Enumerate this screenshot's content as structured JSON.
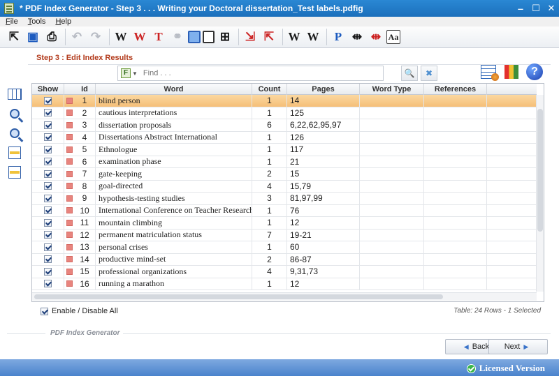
{
  "window": {
    "title": "* PDF Index Generator - Step 3 . . . Writing your Doctoral dissertation_Test labels.pdfig",
    "minimize": "‒",
    "maximize": "☐",
    "close": "✕"
  },
  "menu": {
    "file": "File",
    "tools": "Tools",
    "help": "Help"
  },
  "step": {
    "title": "Step 3 : Edit Index Results"
  },
  "search": {
    "placeholder": "Find . . ."
  },
  "grid": {
    "headers": {
      "show": "Show",
      "id": "Id",
      "word": "Word",
      "count": "Count",
      "pages": "Pages",
      "word_type": "Word Type",
      "references": "References"
    },
    "rows": [
      {
        "id": "1",
        "word": "blind person",
        "count": "1",
        "pages": "14",
        "checked": true,
        "selected": true
      },
      {
        "id": "2",
        "word": "cautious interpretations",
        "count": "1",
        "pages": "125",
        "checked": true
      },
      {
        "id": "3",
        "word": "dissertation proposals",
        "count": "6",
        "pages": "6,22,62,95,97",
        "checked": true
      },
      {
        "id": "4",
        "word": "Dissertations Abstract International",
        "count": "1",
        "pages": "126",
        "checked": true
      },
      {
        "id": "5",
        "word": "Ethnologue",
        "count": "1",
        "pages": "117",
        "checked": true
      },
      {
        "id": "6",
        "word": "examination phase",
        "count": "1",
        "pages": "21",
        "checked": true
      },
      {
        "id": "7",
        "word": "gate-keeping",
        "count": "2",
        "pages": "15",
        "checked": true
      },
      {
        "id": "8",
        "word": "goal-directed",
        "count": "4",
        "pages": "15,79",
        "checked": true
      },
      {
        "id": "9",
        "word": "hypothesis-testing studies",
        "count": "3",
        "pages": "81,97,99",
        "checked": true
      },
      {
        "id": "10",
        "word": "International Conference on Teacher Research",
        "count": "1",
        "pages": "76",
        "checked": true
      },
      {
        "id": "11",
        "word": "mountain climbing",
        "count": "1",
        "pages": "12",
        "checked": true
      },
      {
        "id": "12",
        "word": "permanent matriculation status",
        "count": "7",
        "pages": "19-21",
        "checked": true
      },
      {
        "id": "13",
        "word": "personal crises",
        "count": "1",
        "pages": "60",
        "checked": true
      },
      {
        "id": "14",
        "word": "productive mind-set",
        "count": "2",
        "pages": "86-87",
        "checked": true
      },
      {
        "id": "15",
        "word": "professional organizations",
        "count": "4",
        "pages": "9,31,73",
        "checked": true
      },
      {
        "id": "16",
        "word": "running a marathon",
        "count": "1",
        "pages": "12",
        "checked": true
      }
    ]
  },
  "enable_all": {
    "label": "Enable / Disable All"
  },
  "table_info": {
    "text": "Table: 24 Rows - 1 Selected"
  },
  "footer": {
    "label": "PDF Index Generator"
  },
  "nav": {
    "back": "Back",
    "next": "Next"
  },
  "status": {
    "licensed": "Licensed Version"
  },
  "colors": {
    "accent": "#1b6fbb",
    "selected_row": "#f5bf78",
    "step_title": "#b23a1b",
    "marker": "#e8847e",
    "licensed_ok": "#39b54a"
  }
}
